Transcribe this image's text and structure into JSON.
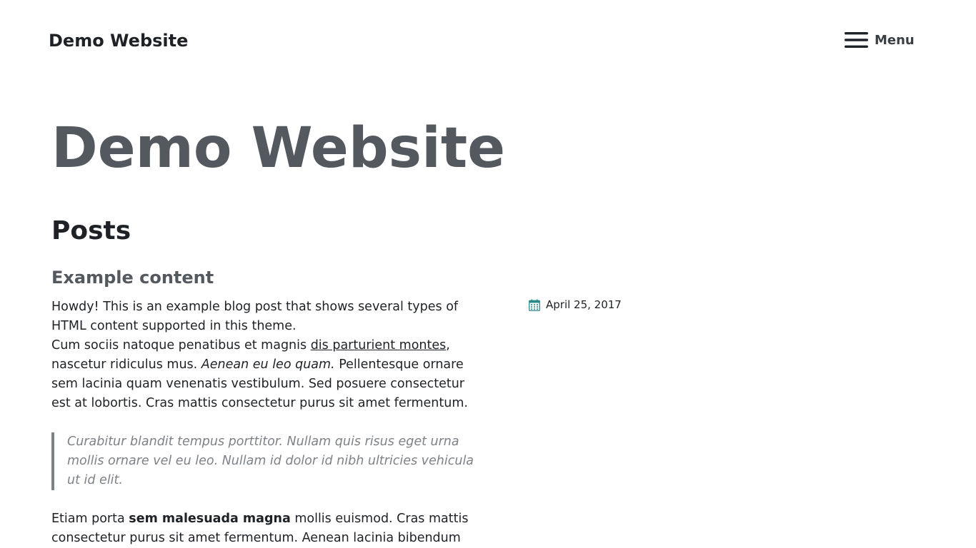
{
  "header": {
    "site_title": "Demo Website",
    "menu_label": "Menu",
    "menu_icon": "hamburger-icon"
  },
  "main": {
    "page_title": "Demo Website",
    "section_title": "Posts",
    "post": {
      "title": "Example content",
      "date": "April 25, 2017",
      "date_icon": "calendar-icon",
      "paragraph1_text1": "Howdy! This is an example blog post that shows several types of HTML content supported in this theme.",
      "paragraph2_text1": "Cum sociis natoque penatibus et magnis ",
      "paragraph2_link": "dis parturient montes",
      "paragraph2_text2": ", nascetur ridiculus mus. ",
      "paragraph2_em": "Aenean eu leo quam.",
      "paragraph2_text3": " Pellentesque ornare sem lacinia quam venenatis vestibulum. Sed posuere consectetur est at lobortis. Cras mattis consectetur purus sit amet fermentum.",
      "blockquote": "Curabitur blandit tempus porttitor. Nullam quis risus eget urna mollis ornare vel eu leo. Nullam id dolor id nibh ultricies vehicula ut id elit.",
      "paragraph3_text1": "Etiam porta ",
      "paragraph3_strong": "sem malesuada magna",
      "paragraph3_text2": " mollis euismod. Cras mattis consectetur purus sit amet fermentum. Aenean lacinia bibendum"
    }
  },
  "colors": {
    "text": "#1e2226",
    "muted_heading": "#53595f",
    "blockquote": "#7d8287",
    "calendar_icon": "#2a8a8a"
  }
}
